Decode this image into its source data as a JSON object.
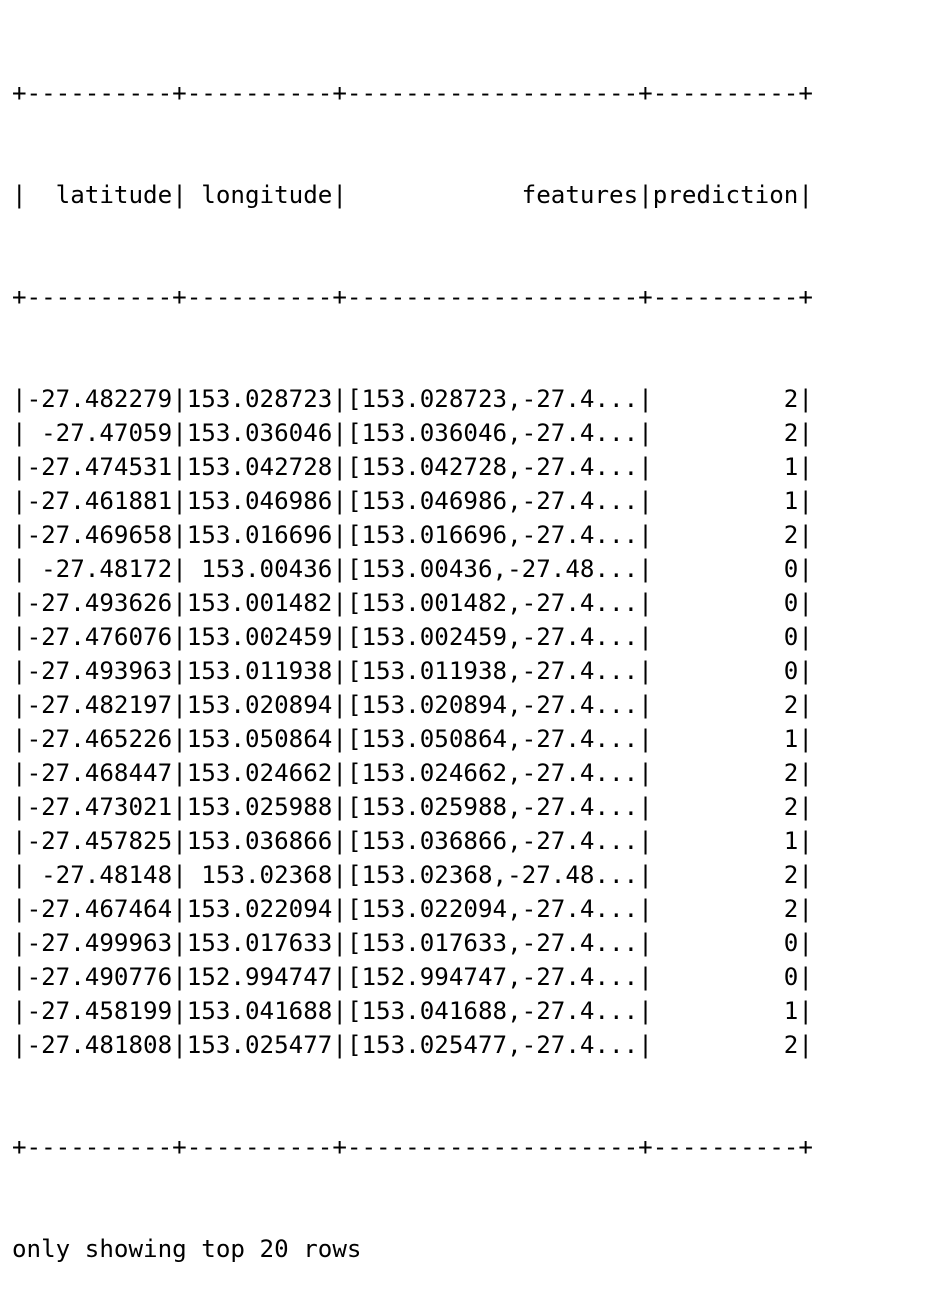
{
  "table": {
    "border": "+----------+----------+--------------------+----------+",
    "columns": [
      {
        "name": "latitude",
        "width": 10,
        "align": "right"
      },
      {
        "name": "longitude",
        "width": 10,
        "align": "right"
      },
      {
        "name": "features",
        "width": 20,
        "align": "right"
      },
      {
        "name": "prediction",
        "width": 10,
        "align": "right"
      }
    ],
    "rows": [
      [
        "-27.482279",
        "153.028723",
        "[153.028723,-27.4...",
        "2"
      ],
      [
        "-27.47059",
        "153.036046",
        "[153.036046,-27.4...",
        "2"
      ],
      [
        "-27.474531",
        "153.042728",
        "[153.042728,-27.4...",
        "1"
      ],
      [
        "-27.461881",
        "153.046986",
        "[153.046986,-27.4...",
        "1"
      ],
      [
        "-27.469658",
        "153.016696",
        "[153.016696,-27.4...",
        "2"
      ],
      [
        "-27.48172",
        "153.00436",
        "[153.00436,-27.48...",
        "0"
      ],
      [
        "-27.493626",
        "153.001482",
        "[153.001482,-27.4...",
        "0"
      ],
      [
        "-27.476076",
        "153.002459",
        "[153.002459,-27.4...",
        "0"
      ],
      [
        "-27.493963",
        "153.011938",
        "[153.011938,-27.4...",
        "0"
      ],
      [
        "-27.482197",
        "153.020894",
        "[153.020894,-27.4...",
        "2"
      ],
      [
        "-27.465226",
        "153.050864",
        "[153.050864,-27.4...",
        "1"
      ],
      [
        "-27.468447",
        "153.024662",
        "[153.024662,-27.4...",
        "2"
      ],
      [
        "-27.473021",
        "153.025988",
        "[153.025988,-27.4...",
        "2"
      ],
      [
        "-27.457825",
        "153.036866",
        "[153.036866,-27.4...",
        "1"
      ],
      [
        "-27.48148",
        "153.02368",
        "[153.02368,-27.48...",
        "2"
      ],
      [
        "-27.467464",
        "153.022094",
        "[153.022094,-27.4...",
        "2"
      ],
      [
        "-27.499963",
        "153.017633",
        "[153.017633,-27.4...",
        "0"
      ],
      [
        "-27.490776",
        "152.994747",
        "[152.994747,-27.4...",
        "0"
      ],
      [
        "-27.458199",
        "153.041688",
        "[153.041688,-27.4...",
        "1"
      ],
      [
        "-27.481808",
        "153.025477",
        "[153.025477,-27.4...",
        "2"
      ]
    ]
  },
  "footer": {
    "text": "only showing top 20 rows"
  },
  "colors": {
    "background": "#ffffff",
    "text": "#000000"
  }
}
